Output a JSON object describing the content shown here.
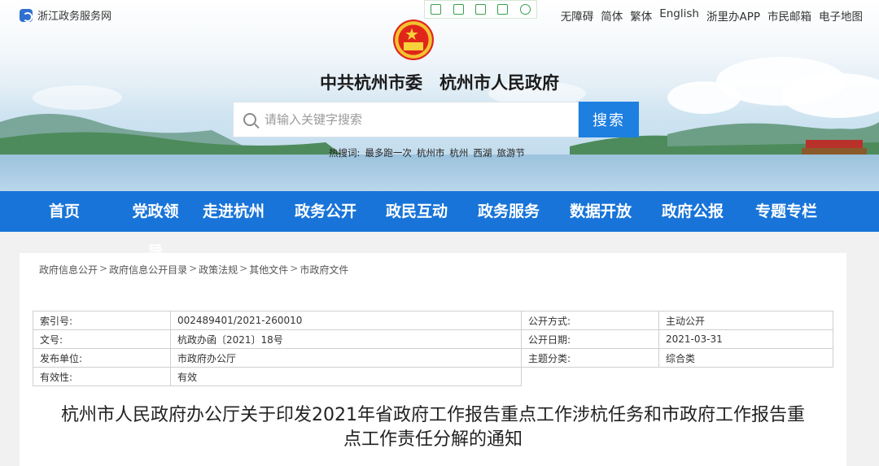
{
  "header": {
    "site_name": "浙江政务服务网",
    "top_links": [
      "无障碍",
      "简体",
      "繁体",
      "English",
      "浙里办APP",
      "市民邮箱",
      "电子地图"
    ],
    "tool_icons": [
      "phone-icon",
      "fullscreen-icon",
      "save-icon",
      "share-icon",
      "settings-icon"
    ],
    "gov_title": "中共杭州市委　杭州市人民政府"
  },
  "search": {
    "placeholder": "请输入关键字搜索",
    "button_label": "搜索",
    "hot_label": "热搜词:",
    "hot_words": [
      "最多跑一次",
      "杭州市",
      "杭州",
      "西湖",
      "旅游节"
    ]
  },
  "nav": {
    "items": [
      "首页",
      "党政领导",
      "走进杭州",
      "政务公开",
      "政民互动",
      "政务服务",
      "数据开放",
      "政府公报",
      "专题专栏"
    ]
  },
  "breadcrumb": [
    "政府信息公开",
    "政府信息公开目录",
    "政策法规",
    "其他文件",
    "市政府文件"
  ],
  "breadcrumb_sep": ">",
  "info": {
    "rows": [
      {
        "k1": "索引号:",
        "v1": "002489401/2021-260010",
        "k2": "公开方式:",
        "v2": "主动公开"
      },
      {
        "k1": "文号:",
        "v1": "杭政办函〔2021〕18号",
        "k2": "公开日期:",
        "v2": "2021-03-31"
      },
      {
        "k1": "发布单位:",
        "v1": "市政府办公厅",
        "k2": "主题分类:",
        "v2": "综合类"
      },
      {
        "k1": "有效性:",
        "v1": "有效"
      }
    ]
  },
  "document": {
    "title_line1": "杭州市人民政府办公厅关于印发2021年省政府工作报告重点工作涉杭任务和市政府工作报告重",
    "title_line2": "点工作责任分解的通知"
  },
  "colors": {
    "nav_bg": "#1874d8",
    "search_button": "#1d7fe0",
    "tool_icon": "#37a04b"
  }
}
